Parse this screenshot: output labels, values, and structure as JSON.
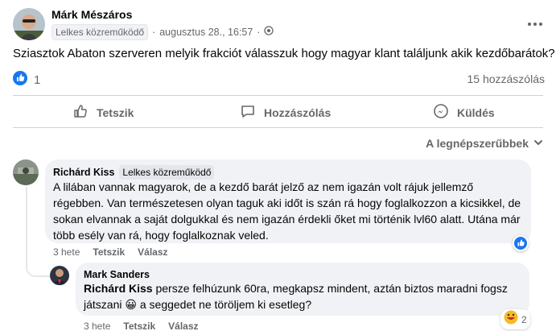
{
  "post": {
    "author": "Márk Mészáros",
    "badge": "Lelkes közreműködő",
    "separator": "·",
    "time": "augusztus 28., 16:57",
    "separator2": "·",
    "text": "Sziasztok Abaton szerveren melyik frakciót válasszuk hogy magyar klant találjunk akik kezdőbarátok?",
    "reaction_count": "1",
    "comment_count": "15 hozzászólás",
    "more_icon": "ellipsis-horizontal-icon",
    "privacy_icon": "globe-icon"
  },
  "actions": {
    "like": "Tetszik",
    "comment": "Hozzászólás",
    "send": "Küldés"
  },
  "sort": {
    "label": "A legnépszerűbbek"
  },
  "comments": [
    {
      "author": "Richárd Kiss",
      "badge": "Lelkes közreműködő",
      "lines": [
        "A lilában vannak magyarok, de a kezdő barát jelző az nem igazán volt rájuk jellemző",
        "régebben. Van természetesen olyan taguk aki időt is szán rá hogy foglalkozzon a kicsikkel, de",
        "sokan elvannak a saját dolgukkal és nem igazán érdekli őket mi történik lvl60 alatt. Utána már",
        "több esély van rá, hogy foglalkoznak veled."
      ],
      "age": "3 hete",
      "like": "Tetszik",
      "reply": "Válasz"
    },
    {
      "author": "Mark Sanders",
      "mention": "Richárd Kiss",
      "line1_rest": "persze felhúzunk 60ra, megkapsz mindent, aztán biztos maradni fogsz",
      "line2_a": "játszani",
      "emoji": "😀",
      "line2_b": "a seggedet ne töröljem ki esetleg?",
      "age": "3 hete",
      "like": "Tetszik",
      "reply": "Válasz",
      "reaction_count": "2"
    }
  ],
  "colors": {
    "like_blue": "#1877f2",
    "muted": "#65676b",
    "bubble": "#f0f2f5"
  }
}
